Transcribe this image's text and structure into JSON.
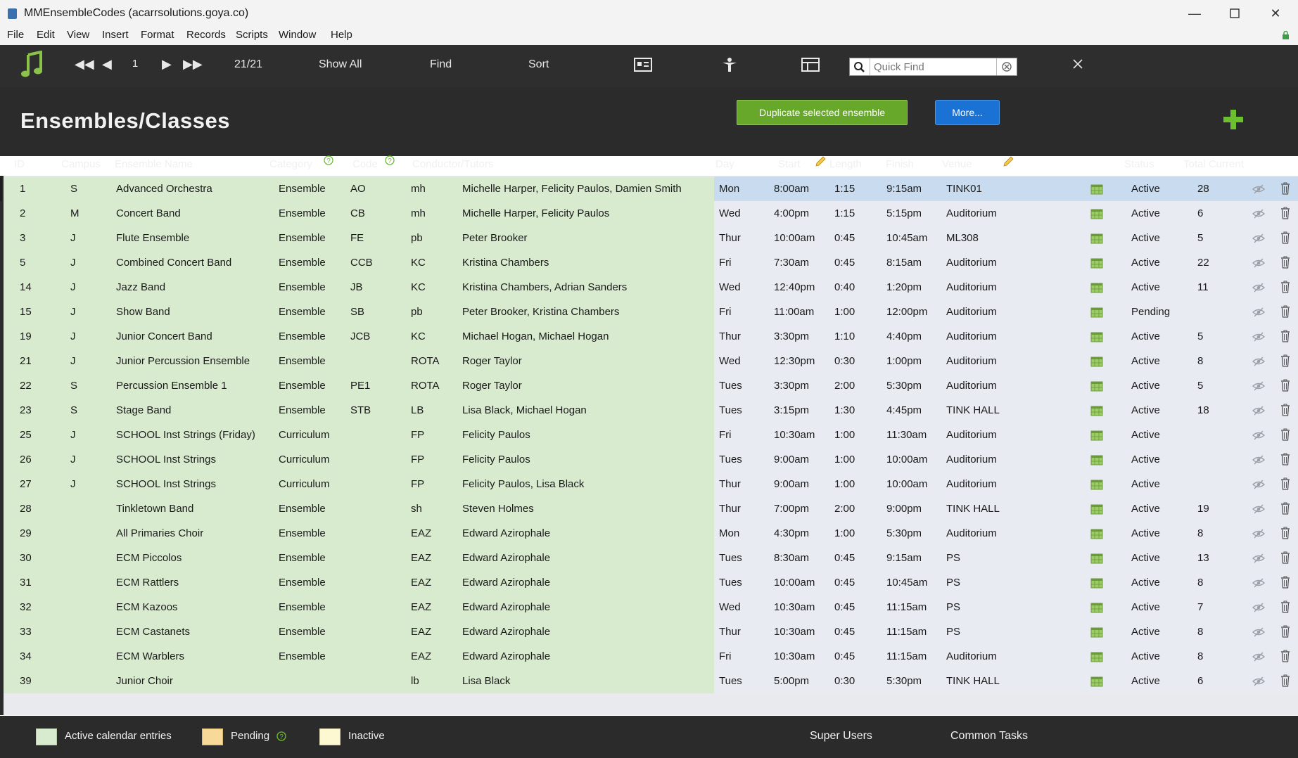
{
  "window": {
    "title": "MMEnsembleCodes (acarrsolutions.goya.co)"
  },
  "menu": [
    "File",
    "Edit",
    "View",
    "Insert",
    "Format",
    "Records",
    "Scripts",
    "Window",
    "Help"
  ],
  "toolbar": {
    "record_number": "1",
    "record_count": "21/21",
    "show_all": "Show All",
    "find": "Find",
    "sort": "Sort",
    "quickfind_placeholder": "Quick Find"
  },
  "header": {
    "title": "Ensembles/Classes",
    "duplicate_label": "Duplicate selected ensemble",
    "more_label": "More..."
  },
  "columns": {
    "id": "ID",
    "campus": "Campus",
    "name": "Ensemble Name",
    "category": "Category",
    "code": "Code",
    "conductor": "Conductor/Tutors",
    "day": "Day",
    "start": "Start",
    "length": "Length",
    "finish": "Finish",
    "venue": "Venue",
    "status": "Status",
    "total": "Total Current"
  },
  "rows": [
    {
      "id": "1",
      "campus": "S",
      "name": "Advanced Orchestra",
      "category": "Ensemble",
      "code": "AO",
      "cond": "mh",
      "tutors": "Michelle Harper, Felicity Paulos, Damien Smith",
      "day": "Mon",
      "start": "8:00am",
      "length": "1:15",
      "finish": "9:15am",
      "venue": "TINK01",
      "status": "Active",
      "total": "28"
    },
    {
      "id": "2",
      "campus": "M",
      "name": "Concert Band",
      "category": "Ensemble",
      "code": "CB",
      "cond": "mh",
      "tutors": "Michelle Harper, Felicity Paulos",
      "day": "Wed",
      "start": "4:00pm",
      "length": "1:15",
      "finish": "5:15pm",
      "venue": "Auditorium",
      "status": "Active",
      "total": "6"
    },
    {
      "id": "3",
      "campus": "J",
      "name": "Flute Ensemble",
      "category": "Ensemble",
      "code": "FE",
      "cond": "pb",
      "tutors": "Peter Brooker",
      "day": "Thur",
      "start": "10:00am",
      "length": "0:45",
      "finish": "10:45am",
      "venue": "ML308",
      "status": "Active",
      "total": "5"
    },
    {
      "id": "5",
      "campus": "J",
      "name": "Combined Concert Band",
      "category": "Ensemble",
      "code": "CCB",
      "cond": "KC",
      "tutors": "Kristina Chambers",
      "day": "Fri",
      "start": "7:30am",
      "length": "0:45",
      "finish": "8:15am",
      "venue": "Auditorium",
      "status": "Active",
      "total": "22"
    },
    {
      "id": "14",
      "campus": "J",
      "name": "Jazz Band",
      "category": "Ensemble",
      "code": "JB",
      "cond": "KC",
      "tutors": "Kristina Chambers, Adrian Sanders",
      "day": "Wed",
      "start": "12:40pm",
      "length": "0:40",
      "finish": "1:20pm",
      "venue": "Auditorium",
      "status": "Active",
      "total": "11"
    },
    {
      "id": "15",
      "campus": "J",
      "name": "Show Band",
      "category": "Ensemble",
      "code": "SB",
      "cond": "pb",
      "tutors": "Peter Brooker, Kristina Chambers",
      "day": "Fri",
      "start": "11:00am",
      "length": "1:00",
      "finish": "12:00pm",
      "venue": "Auditorium",
      "status": "Pending",
      "total": ""
    },
    {
      "id": "19",
      "campus": "J",
      "name": "Junior Concert Band",
      "category": "Ensemble",
      "code": "JCB",
      "cond": "KC",
      "tutors": "Michael Hogan, Michael Hogan",
      "day": "Thur",
      "start": "3:30pm",
      "length": "1:10",
      "finish": "4:40pm",
      "venue": "Auditorium",
      "status": "Active",
      "total": "5"
    },
    {
      "id": "21",
      "campus": "J",
      "name": "Junior Percussion Ensemble",
      "category": "Ensemble",
      "code": "",
      "cond": "ROTA",
      "tutors": "Roger Taylor",
      "day": "Wed",
      "start": "12:30pm",
      "length": "0:30",
      "finish": "1:00pm",
      "venue": "Auditorium",
      "status": "Active",
      "total": "8"
    },
    {
      "id": "22",
      "campus": "S",
      "name": "Percussion Ensemble 1",
      "category": "Ensemble",
      "code": "PE1",
      "cond": "ROTA",
      "tutors": "Roger Taylor",
      "day": "Tues",
      "start": "3:30pm",
      "length": "2:00",
      "finish": "5:30pm",
      "venue": "Auditorium",
      "status": "Active",
      "total": "5"
    },
    {
      "id": "23",
      "campus": "S",
      "name": "Stage Band",
      "category": "Ensemble",
      "code": "STB",
      "cond": "LB",
      "tutors": "Lisa Black, Michael Hogan",
      "day": "Tues",
      "start": "3:15pm",
      "length": "1:30",
      "finish": "4:45pm",
      "venue": "TINK HALL",
      "status": "Active",
      "total": "18"
    },
    {
      "id": "25",
      "campus": "J",
      "name": "SCHOOL Inst Strings (Friday)",
      "category": "Curriculum",
      "code": "",
      "cond": "FP",
      "tutors": "Felicity Paulos",
      "day": "Fri",
      "start": "10:30am",
      "length": "1:00",
      "finish": "11:30am",
      "venue": "Auditorium",
      "status": "Active",
      "total": ""
    },
    {
      "id": "26",
      "campus": "J",
      "name": "SCHOOL Inst Strings",
      "category": "Curriculum",
      "code": "",
      "cond": "FP",
      "tutors": "Felicity Paulos",
      "day": "Tues",
      "start": "9:00am",
      "length": "1:00",
      "finish": "10:00am",
      "venue": "Auditorium",
      "status": "Active",
      "total": ""
    },
    {
      "id": "27",
      "campus": "J",
      "name": "SCHOOL Inst Strings",
      "category": "Curriculum",
      "code": "",
      "cond": "FP",
      "tutors": "Felicity Paulos, Lisa Black",
      "day": "Thur",
      "start": "9:00am",
      "length": "1:00",
      "finish": "10:00am",
      "venue": "Auditorium",
      "status": "Active",
      "total": ""
    },
    {
      "id": "28",
      "campus": "",
      "name": "Tinkletown Band",
      "category": "Ensemble",
      "code": "",
      "cond": "sh",
      "tutors": "Steven Holmes",
      "day": "Thur",
      "start": "7:00pm",
      "length": "2:00",
      "finish": "9:00pm",
      "venue": "TINK HALL",
      "status": "Active",
      "total": "19"
    },
    {
      "id": "29",
      "campus": "",
      "name": "All Primaries Choir",
      "category": "Ensemble",
      "code": "",
      "cond": "EAZ",
      "tutors": "Edward Azirophale",
      "day": "Mon",
      "start": "4:30pm",
      "length": "1:00",
      "finish": "5:30pm",
      "venue": "Auditorium",
      "status": "Active",
      "total": "8"
    },
    {
      "id": "30",
      "campus": "",
      "name": "ECM Piccolos",
      "category": "Ensemble",
      "code": "",
      "cond": "EAZ",
      "tutors": "Edward Azirophale",
      "day": "Tues",
      "start": "8:30am",
      "length": "0:45",
      "finish": "9:15am",
      "venue": "PS",
      "status": "Active",
      "total": "13"
    },
    {
      "id": "31",
      "campus": "",
      "name": "ECM Rattlers",
      "category": "Ensemble",
      "code": "",
      "cond": "EAZ",
      "tutors": "Edward Azirophale",
      "day": "Tues",
      "start": "10:00am",
      "length": "0:45",
      "finish": "10:45am",
      "venue": "PS",
      "status": "Active",
      "total": "8"
    },
    {
      "id": "32",
      "campus": "",
      "name": "ECM Kazoos",
      "category": "Ensemble",
      "code": "",
      "cond": "EAZ",
      "tutors": "Edward Azirophale",
      "day": "Wed",
      "start": "10:30am",
      "length": "0:45",
      "finish": "11:15am",
      "venue": "PS",
      "status": "Active",
      "total": "7"
    },
    {
      "id": "33",
      "campus": "",
      "name": "ECM Castanets",
      "category": "Ensemble",
      "code": "",
      "cond": "EAZ",
      "tutors": "Edward Azirophale",
      "day": "Thur",
      "start": "10:30am",
      "length": "0:45",
      "finish": "11:15am",
      "venue": "PS",
      "status": "Active",
      "total": "8"
    },
    {
      "id": "34",
      "campus": "",
      "name": "ECM Warblers",
      "category": "Ensemble",
      "code": "",
      "cond": "EAZ",
      "tutors": "Edward Azirophale",
      "day": "Fri",
      "start": "10:30am",
      "length": "0:45",
      "finish": "11:15am",
      "venue": "Auditorium",
      "status": "Active",
      "total": "8"
    },
    {
      "id": "39",
      "campus": "",
      "name": "Junior Choir",
      "category": "",
      "code": "",
      "cond": "lb",
      "tutors": "Lisa Black",
      "day": "Tues",
      "start": "5:00pm",
      "length": "0:30",
      "finish": "5:30pm",
      "venue": "TINK HALL",
      "status": "Active",
      "total": "6"
    }
  ],
  "legend": {
    "active": "Active calendar entries",
    "pending": "Pending",
    "inactive": "Inactive"
  },
  "footer": {
    "super_users": "Super Users",
    "common_tasks": "Common Tasks"
  },
  "colors": {
    "active_green": "#d8ebcf",
    "pending_orange": "#f7d99a",
    "inactive_yellow": "#fdf7d2",
    "button_green": "#67a82b",
    "button_blue": "#1a73d4",
    "selected_row": "#c9dcef"
  }
}
